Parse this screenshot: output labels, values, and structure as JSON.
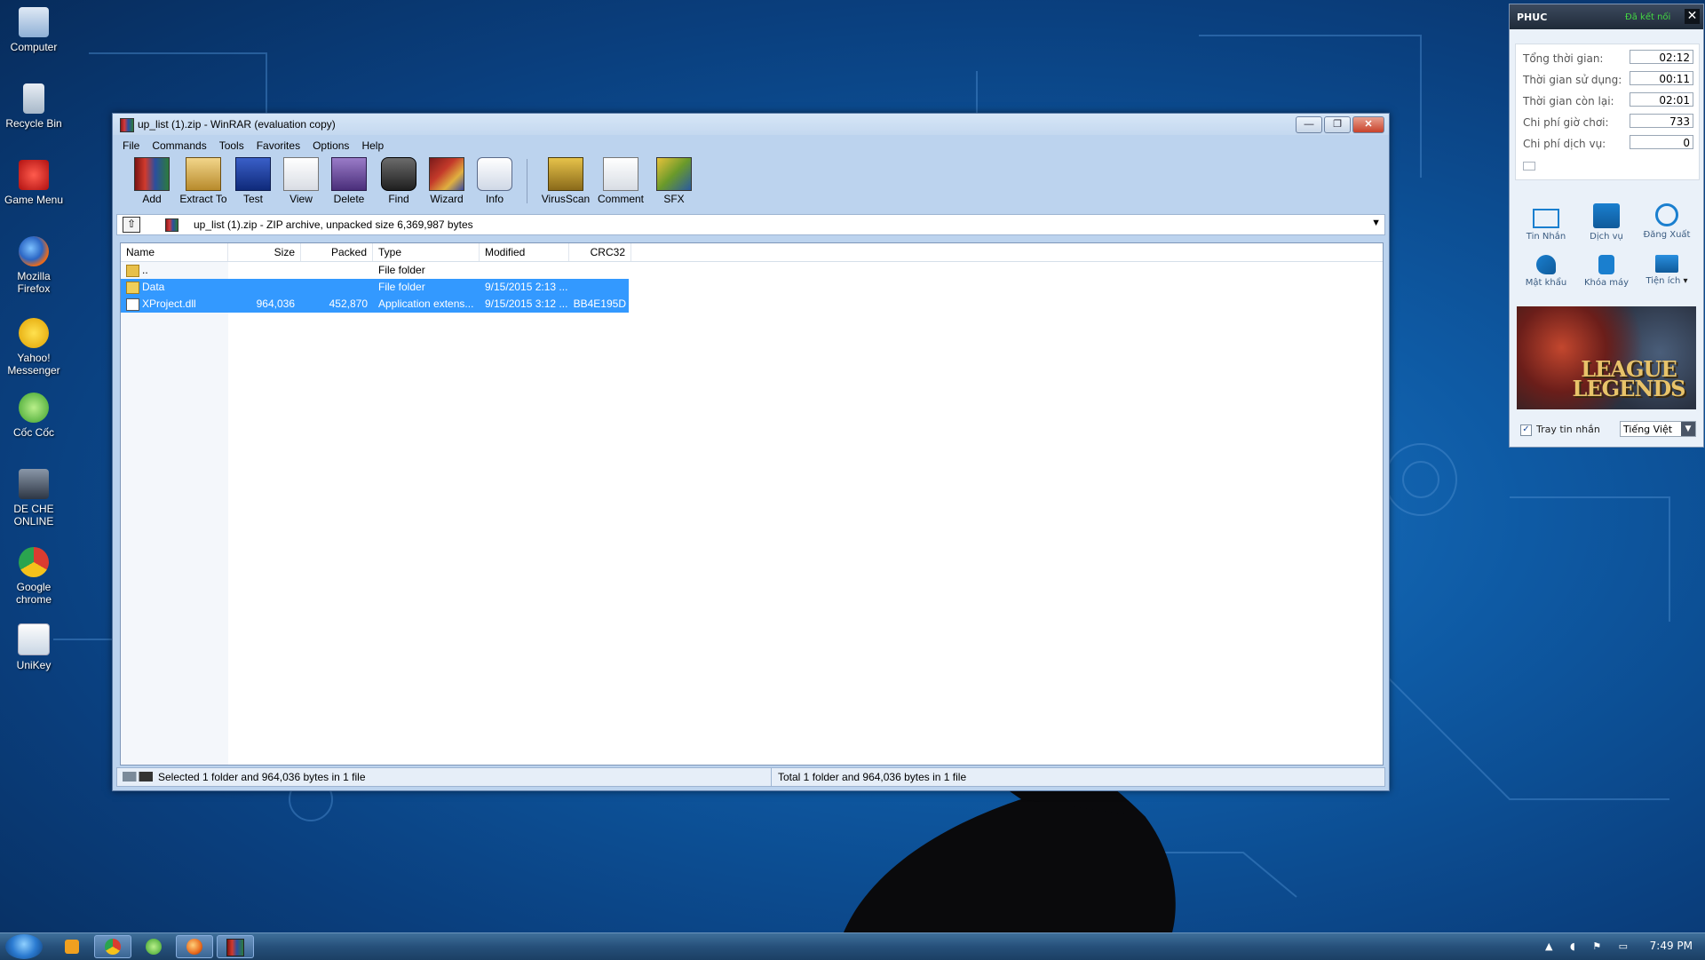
{
  "desktop": {
    "icons": [
      {
        "label": "Computer",
        "icon": "computer-icon"
      },
      {
        "label": "Recycle Bin",
        "icon": "recycle-bin-icon"
      },
      {
        "label": "Game Menu",
        "icon": "game-menu-icon"
      },
      {
        "label": "Mozilla Firefox",
        "icon": "firefox-icon"
      },
      {
        "label": "Yahoo! Messenger",
        "icon": "yahoo-messenger-icon"
      },
      {
        "label": "Cốc Cốc",
        "icon": "coc-coc-icon"
      },
      {
        "label": "DE CHE ONLINE",
        "icon": "de-che-online-icon"
      },
      {
        "label": "Google chrome",
        "icon": "chrome-icon"
      },
      {
        "label": "UniKey",
        "icon": "unikey-icon"
      }
    ]
  },
  "winrar": {
    "title": "up_list (1).zip - WinRAR (evaluation copy)",
    "menu": [
      "File",
      "Commands",
      "Tools",
      "Favorites",
      "Options",
      "Help"
    ],
    "toolbar": [
      {
        "label": "Add",
        "icon": "add-icon"
      },
      {
        "label": "Extract To",
        "icon": "extract-to-icon"
      },
      {
        "label": "Test",
        "icon": "test-icon"
      },
      {
        "label": "View",
        "icon": "view-icon"
      },
      {
        "label": "Delete",
        "icon": "delete-icon"
      },
      {
        "label": "Find",
        "icon": "find-icon"
      },
      {
        "label": "Wizard",
        "icon": "wizard-icon"
      },
      {
        "label": "Info",
        "icon": "info-icon"
      },
      {
        "label": "VirusScan",
        "icon": "virus-scan-icon"
      },
      {
        "label": "Comment",
        "icon": "comment-icon"
      },
      {
        "label": "SFX",
        "icon": "sfx-icon"
      }
    ],
    "address": "up_list (1).zip - ZIP archive, unpacked size 6,369,987 bytes",
    "columns": [
      "Name",
      "Size",
      "Packed",
      "Type",
      "Modified",
      "CRC32"
    ],
    "rows": [
      {
        "name": "..",
        "size": "",
        "packed": "",
        "type": "File folder",
        "modified": "",
        "crc": "",
        "selected": false,
        "kind": "folder"
      },
      {
        "name": "Data",
        "size": "",
        "packed": "",
        "type": "File folder",
        "modified": "9/15/2015 2:13 ...",
        "crc": "",
        "selected": true,
        "kind": "folder"
      },
      {
        "name": "XProject.dll",
        "size": "964,036",
        "packed": "452,870",
        "type": "Application extens...",
        "modified": "9/15/2015 3:12 ...",
        "crc": "BB4E195D",
        "selected": true,
        "kind": "dll"
      }
    ],
    "status_left": "Selected 1 folder and 964,036 bytes in 1 file",
    "status_right": "Total 1 folder and 964,036 bytes in 1 file"
  },
  "panel": {
    "user": "PHUC",
    "connection": "Đã kết nối",
    "stats": [
      {
        "label": "Tổng thời gian:",
        "value": "02:12"
      },
      {
        "label": "Thời gian sử dụng:",
        "value": "00:11"
      },
      {
        "label": "Thời gian còn lại:",
        "value": "02:01"
      },
      {
        "label": "Chi phí giờ chơi:",
        "value": "733"
      },
      {
        "label": "Chi phí dịch vụ:",
        "value": "0"
      }
    ],
    "actions": [
      {
        "label": "Tin Nhắn",
        "icon": "message-icon"
      },
      {
        "label": "Dịch vụ",
        "icon": "service-icon"
      },
      {
        "label": "Đăng Xuất",
        "icon": "power-icon"
      },
      {
        "label": "Mật khẩu",
        "icon": "key-icon"
      },
      {
        "label": "Khóa máy",
        "icon": "lock-icon"
      },
      {
        "label": "Tiện ích",
        "icon": "utilities-icon"
      }
    ],
    "banner_text": "LEAGUE LEGENDS",
    "tray_checkbox": "Tray tin nhắn",
    "language": "Tiếng Việt"
  },
  "taskbar": {
    "clock": "7:49 PM"
  }
}
